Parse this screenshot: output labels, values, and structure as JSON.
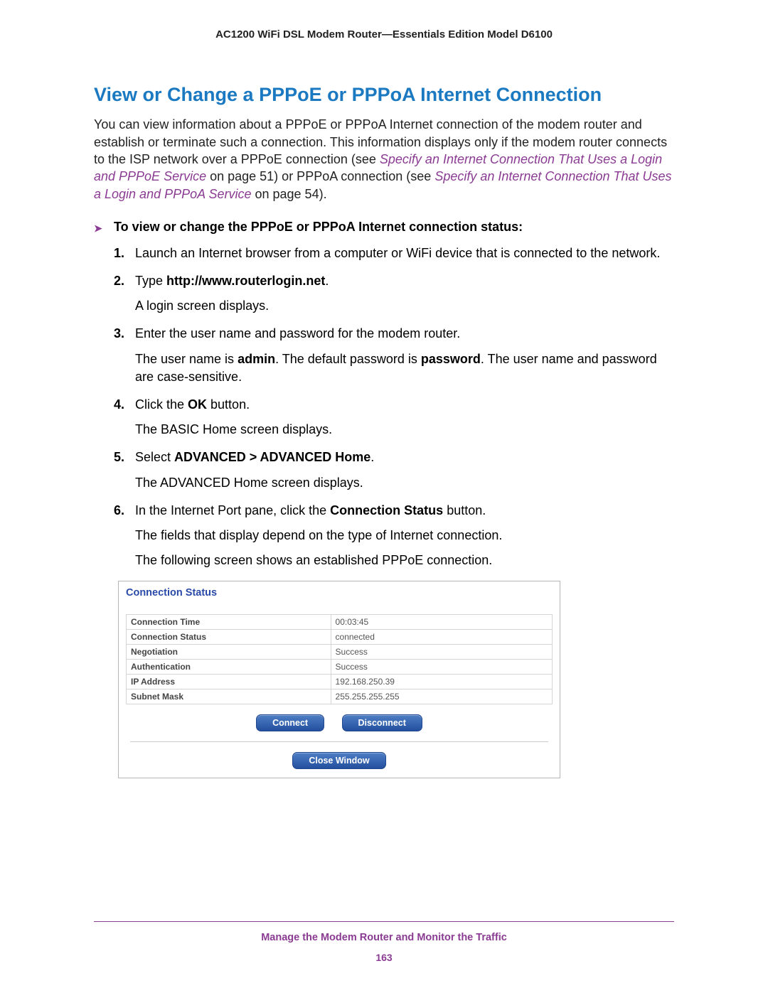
{
  "header": "AC1200 WiFi DSL Modem Router—Essentials Edition Model D6100",
  "heading": "View or Change a PPPoE or PPPoA Internet Connection",
  "intro": {
    "t1": "You can view information about a PPPoE or PPPoA Internet connection of the modem router and establish or terminate such a connection. This information displays only if the modem router connects to the ISP network over a PPPoE connection (see ",
    "link1": "Specify an Internet Connection That Uses a Login and PPPoE Service",
    "t2": " on page 51) or PPPoA connection (see ",
    "link2": "Specify an Internet Connection That Uses a Login and PPPoA Service",
    "t3": " on page 54)."
  },
  "proc_heading": "To view or change the PPPoE or PPPoA Internet connection status:",
  "steps": {
    "s1": "Launch an Internet browser from a computer or WiFi device that is connected to the network.",
    "s2a": "Type ",
    "s2b": "http://www.routerlogin.net",
    "s2c": ".",
    "s2p": "A login screen displays.",
    "s3": "Enter the user name and password for the modem router.",
    "s3p_a": "The user name is ",
    "s3p_b": "admin",
    "s3p_c": ". The default password is ",
    "s3p_d": "password",
    "s3p_e": ". The user name and password are case-sensitive.",
    "s4a": "Click the ",
    "s4b": "OK",
    "s4c": " button.",
    "s4p": "The BASIC Home screen displays.",
    "s5a": "Select ",
    "s5b": "ADVANCED > ADVANCED Home",
    "s5c": ".",
    "s5p": "The ADVANCED Home screen displays.",
    "s6a": "In the Internet Port pane, click the ",
    "s6b": "Connection Status",
    "s6c": " button.",
    "s6p1": "The fields that display depend on the type of Internet connection.",
    "s6p2": "The following screen shows an established PPPoE connection."
  },
  "screenshot": {
    "title": "Connection Status",
    "rows": [
      {
        "label": "Connection Time",
        "value": "00:03:45"
      },
      {
        "label": "Connection Status",
        "value": "connected"
      },
      {
        "label": "Negotiation",
        "value": "Success"
      },
      {
        "label": "Authentication",
        "value": "Success"
      },
      {
        "label": "IP Address",
        "value": "192.168.250.39"
      },
      {
        "label": "Subnet Mask",
        "value": "255.255.255.255"
      }
    ],
    "btn_connect": "Connect",
    "btn_disconnect": "Disconnect",
    "btn_close": "Close Window"
  },
  "footer": {
    "text": "Manage the Modem Router and Monitor the Traffic",
    "page": "163"
  }
}
